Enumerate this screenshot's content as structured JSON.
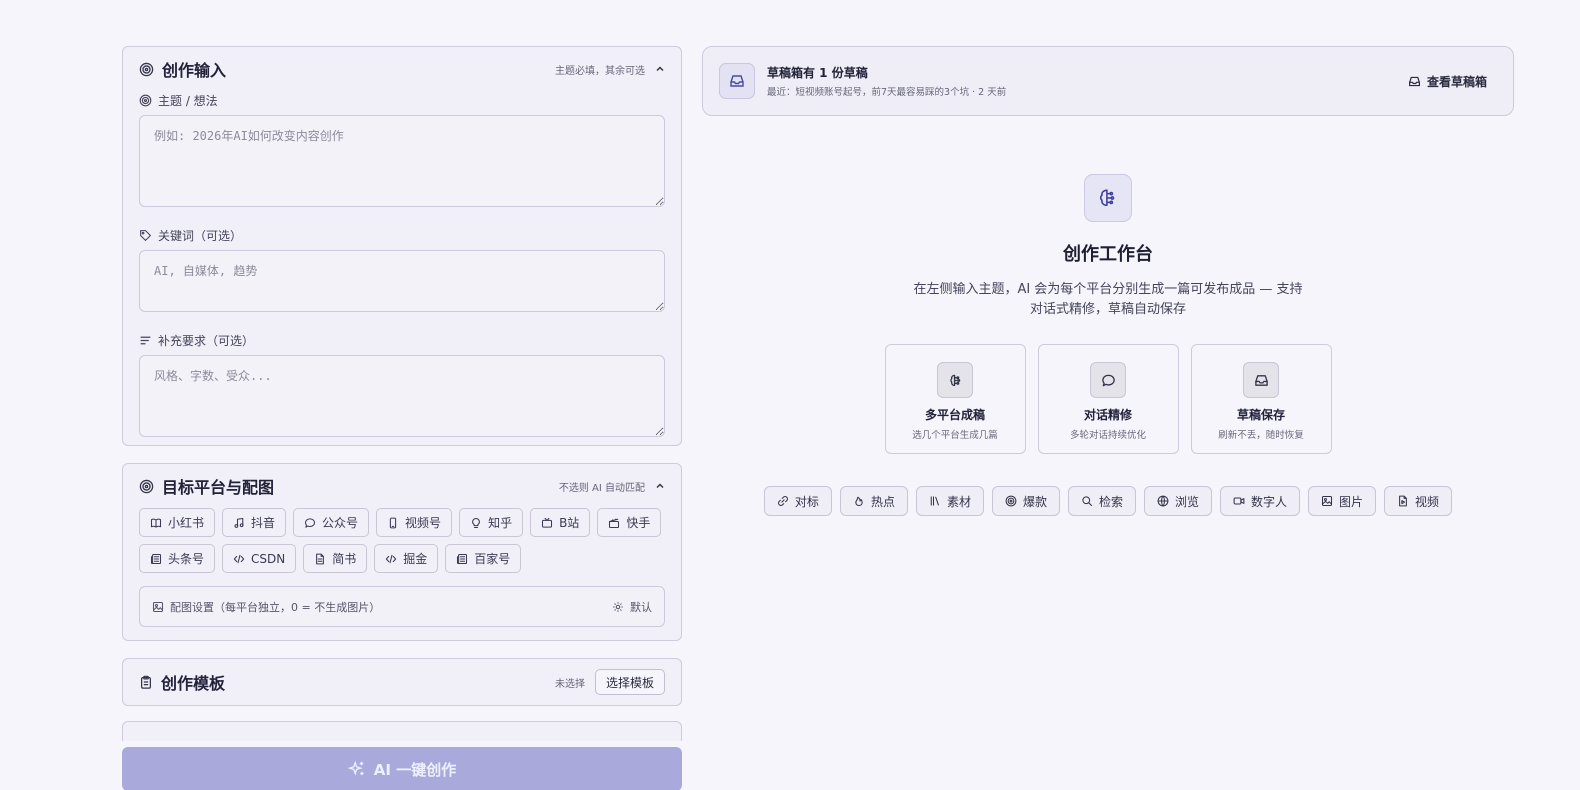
{
  "input_card": {
    "title": "创作输入",
    "hint": "主题必填，其余可选",
    "topic_label": "主题 / 想法",
    "topic_placeholder": "例如: 2026年AI如何改变内容创作",
    "keywords_label": "关键词（可选）",
    "keywords_placeholder": "AI, 自媒体, 趋势",
    "extra_label": "补充要求（可选）",
    "extra_placeholder": "风格、字数、受众..."
  },
  "platform_card": {
    "title": "目标平台与配图",
    "hint": "不选则 AI 自动匹配",
    "platforms": [
      {
        "label": "小红书",
        "icon": "book-icon"
      },
      {
        "label": "抖音",
        "icon": "music-note-icon"
      },
      {
        "label": "公众号",
        "icon": "chat-bubble-icon"
      },
      {
        "label": "视频号",
        "icon": "phone-icon"
      },
      {
        "label": "知乎",
        "icon": "lightbulb-icon"
      },
      {
        "label": "B站",
        "icon": "tv-icon"
      },
      {
        "label": "快手",
        "icon": "clapperboard-icon"
      },
      {
        "label": "头条号",
        "icon": "newspaper-icon"
      },
      {
        "label": "CSDN",
        "icon": "code-icon"
      },
      {
        "label": "简书",
        "icon": "document-icon"
      },
      {
        "label": "掘金",
        "icon": "code-icon"
      },
      {
        "label": "百家号",
        "icon": "newspaper-icon"
      }
    ],
    "image_settings_label": "配图设置（每平台独立，0 = 不生成图片）",
    "image_settings_default": "默认"
  },
  "template_card": {
    "title": "创作模板",
    "status": "未选择",
    "select_button": "选择模板"
  },
  "create_button": "AI 一键创作",
  "draft_bar": {
    "title": "草稿箱有 1 份草稿",
    "subtitle": "最近：短视频账号起号，前7天最容易踩的3个坑 · 2 天前",
    "view_button": "查看草稿箱"
  },
  "hero": {
    "title": "创作工作台",
    "description": "在左侧输入主题，AI 会为每个平台分别生成一篇可发布成品 — 支持对话式精修，草稿自动保存"
  },
  "features": [
    {
      "title": "多平台成稿",
      "desc": "选几个平台生成几篇",
      "icon": "brain-icon"
    },
    {
      "title": "对话精修",
      "desc": "多轮对话持续优化",
      "icon": "chat-bubble-icon"
    },
    {
      "title": "草稿保存",
      "desc": "刷新不丢，随时恢复",
      "icon": "inbox-icon"
    }
  ],
  "tools": [
    {
      "label": "对标",
      "icon": "link-icon"
    },
    {
      "label": "热点",
      "icon": "flame-icon"
    },
    {
      "label": "素材",
      "icon": "library-icon"
    },
    {
      "label": "爆款",
      "icon": "target-icon"
    },
    {
      "label": "检索",
      "icon": "search-icon"
    },
    {
      "label": "浏览",
      "icon": "globe-icon"
    },
    {
      "label": "数字人",
      "icon": "video-camera-icon"
    },
    {
      "label": "图片",
      "icon": "image-icon"
    },
    {
      "label": "视频",
      "icon": "video-file-icon"
    }
  ],
  "colors": {
    "background": "#f6f5fb",
    "card": "#f1eff7",
    "accent_button": "#a9aadb",
    "icon_accent": "#4a4aa0"
  }
}
